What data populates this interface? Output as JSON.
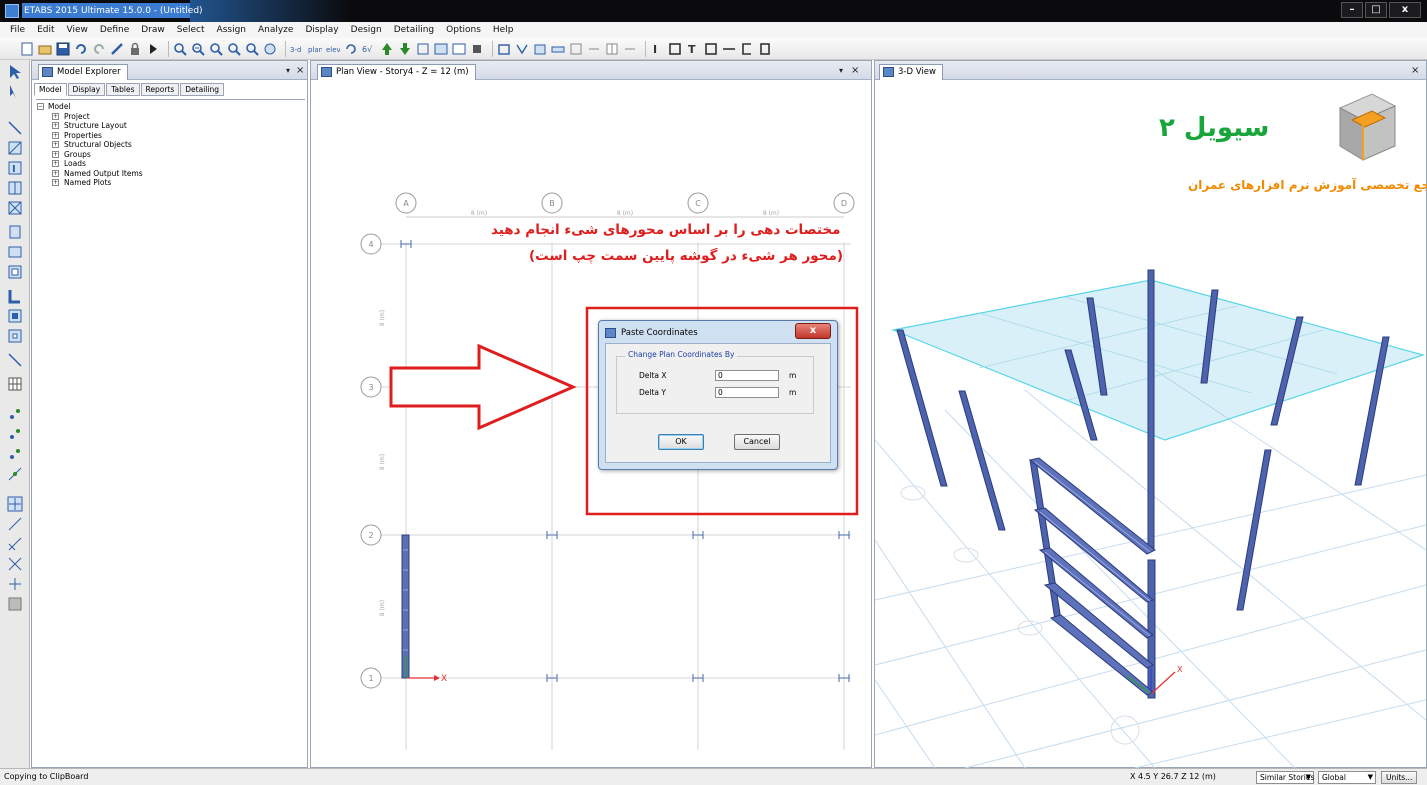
{
  "window": {
    "title": "ETABS 2015 Ultimate 15.0.0 - (Untitled)",
    "buttons": {
      "minimize": "–",
      "maximize": "□",
      "close": "x"
    }
  },
  "menu": [
    "File",
    "Edit",
    "View",
    "Define",
    "Draw",
    "Select",
    "Assign",
    "Analyze",
    "Display",
    "Design",
    "Detailing",
    "Options",
    "Help"
  ],
  "panels": {
    "explorer": {
      "title": "Model Explorer",
      "pin": "▾",
      "close": "×",
      "subtabs": [
        "Model",
        "Display",
        "Tables",
        "Reports",
        "Detailing"
      ],
      "tree_root": "Model",
      "tree_items": [
        "Project",
        "Structure Layout",
        "Properties",
        "Structural Objects",
        "Groups",
        "Loads",
        "Named Output Items",
        "Named Plots"
      ]
    },
    "plan": {
      "title": "Plan View - Story4 - Z = 12 (m)",
      "pin": "▾",
      "close": "×",
      "grid_columns": [
        "A",
        "B",
        "C",
        "D"
      ],
      "grid_rows": [
        "4",
        "3",
        "2",
        "1"
      ],
      "span_label": "8 (m)",
      "axis_label": "X"
    },
    "view3d": {
      "title": "3-D View",
      "close": "×"
    }
  },
  "annotation": {
    "line1": "مختصات دهی را بر اساس محورهای شیء انجام دهید",
    "line2": "(محور هر شیء در گوشه پایین سمت چپ است)",
    "color": "#e01d1d"
  },
  "dialog": {
    "title": "Paste Coordinates",
    "close": "x",
    "group_label": "Change Plan Coordinates By",
    "delta_x_label": "Delta X",
    "delta_x_value": "0",
    "delta_y_label": "Delta Y",
    "delta_y_value": "0",
    "unit": "m",
    "ok": "OK",
    "cancel": "Cancel"
  },
  "brand": {
    "name": "سیویل ۲",
    "tagline": "مرجع تخصصی آموزش نرم افزارهای عمران",
    "color": "#18a53a"
  },
  "status": {
    "message": "Copying to ClipBoard",
    "coords": "X 4.5  Y 26.7  Z 12 (m)",
    "story_mode": "Similar Stories",
    "coord_system": "Global",
    "units_button": "Units..."
  }
}
